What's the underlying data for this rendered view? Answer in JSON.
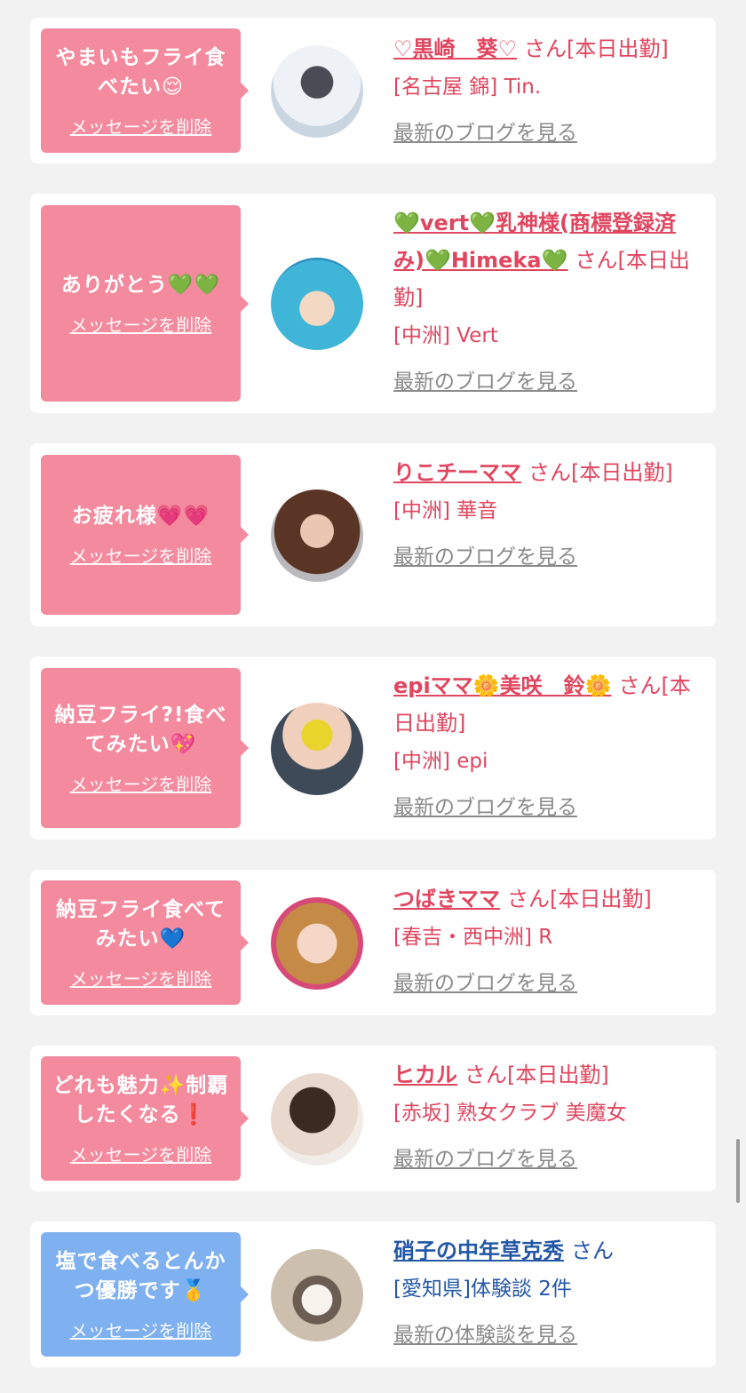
{
  "cards": [
    {
      "message": "やまいもフライ食べたい😌",
      "delete_label": "メッセージを削除",
      "name": "♡黒崎　葵♡",
      "honorific": "さん",
      "status": "[本日出勤]",
      "store": "[名古屋 錦] Tin.",
      "blog_link": "最新のブログを見る"
    },
    {
      "message": "ありがとう💚💚",
      "delete_label": "メッセージを削除",
      "name": "💚vert💚乳神様(商標登録済み)💚Himeka💚",
      "honorific": "さん",
      "status": "[本日出勤]",
      "store": "[中洲] Vert",
      "blog_link": "最新のブログを見る"
    },
    {
      "message": "お疲れ様💗💗",
      "delete_label": "メッセージを削除",
      "name": "りこチーママ",
      "honorific": "さん",
      "status": "[本日出勤]",
      "store": "[中洲] 華音",
      "blog_link": "最新のブログを見る"
    },
    {
      "message": "納豆フライ?!食べてみたい💖",
      "delete_label": "メッセージを削除",
      "name": "epiママ🌼美咲　鈴🌼",
      "honorific": "さん",
      "status": "[本日出勤]",
      "store": "[中洲] epi",
      "blog_link": "最新のブログを見る"
    },
    {
      "message": "納豆フライ食べてみたい💙",
      "delete_label": "メッセージを削除",
      "name": "つばきママ",
      "honorific": "さん",
      "status": "[本日出勤]",
      "store": "[春吉・西中洲] R",
      "blog_link": "最新のブログを見る"
    },
    {
      "message": "どれも魅力✨制覇したくなる❗️",
      "delete_label": "メッセージを削除",
      "name": "ヒカル",
      "honorific": "さん",
      "status": "[本日出勤]",
      "store": "[赤坂] 熟女クラブ 美魔女",
      "blog_link": "最新のブログを見る"
    },
    {
      "message": "塩で食べるとんかつ優勝です🥇",
      "delete_label": "メッセージを削除",
      "name": "硝子の中年草克秀",
      "honorific": "さん",
      "status": "",
      "store": "[愛知県]体験談 2件",
      "blog_link": "最新の体験談を見る"
    }
  ],
  "colors": {
    "pink_bubble": "#f48a9e",
    "blue_bubble": "#7fb0f0",
    "name_pink": "#e0465f",
    "name_blue": "#2457a6",
    "background": "#f2f2f3"
  }
}
